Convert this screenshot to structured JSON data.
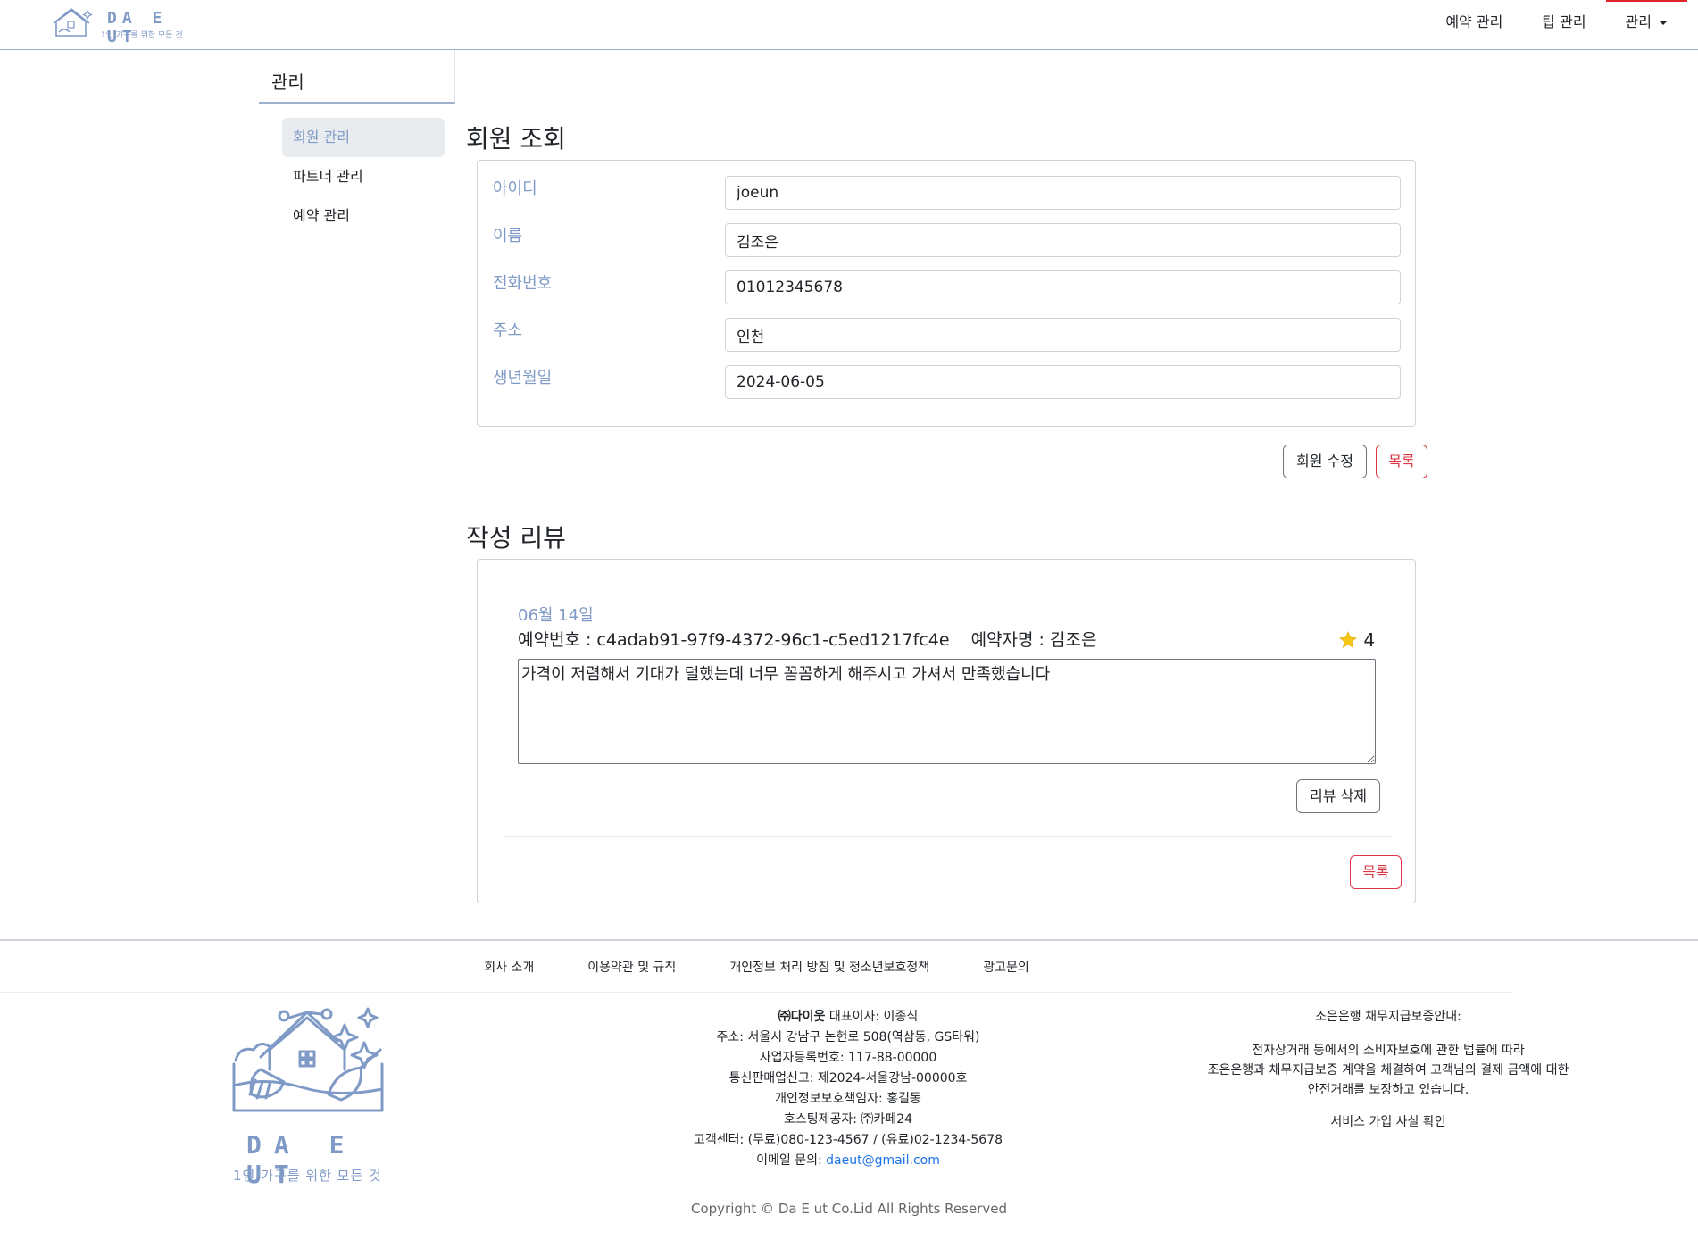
{
  "brand": {
    "name": "DA E UT",
    "tagline": "1인 가구를 위한 모든 것"
  },
  "nav": {
    "items": [
      "예약 관리",
      "팁 관리"
    ],
    "dropdown_label": "관리"
  },
  "sidebar": {
    "title": "관리",
    "items": [
      {
        "label": "회원 관리",
        "active": true
      },
      {
        "label": "파트너 관리",
        "active": false
      },
      {
        "label": "예약 관리",
        "active": false
      }
    ]
  },
  "member": {
    "title": "회원 조회",
    "fields": [
      {
        "label": "아이디",
        "value": "joeun"
      },
      {
        "label": "이름",
        "value": "김조은"
      },
      {
        "label": "전화번호",
        "value": "01012345678"
      },
      {
        "label": "주소",
        "value": "인천"
      },
      {
        "label": "생년월일",
        "value": "2024-06-05"
      }
    ],
    "edit_button": "회원 수정",
    "list_button": "목록"
  },
  "reviews": {
    "title": "작성 리뷰",
    "items": [
      {
        "date": "06월 14일",
        "reservation_label": "예약번호 : ",
        "reservation_no": "c4adab91-97f9-4372-96c1-c5ed1217fc4e",
        "booker_label": "예약자명 : ",
        "booker": "김조은",
        "rating": "4",
        "content": "가격이 저렴해서 기대가 덜했는데 너무 꼼꼼하게 해주시고 가셔서 만족했습니다",
        "delete_button": "리뷰 삭제"
      }
    ],
    "list_button": "목록"
  },
  "footer": {
    "links": [
      "회사 소개",
      "이용약관 및 규칙",
      "개인정보 처리 방침 및 청소년보호정책",
      "광고문의"
    ],
    "company": {
      "name": "㈜다이웃",
      "ceo": " 대표이사: 이종식",
      "address": "주소: 서울시 강남구 논현로 508(역삼동, GS타워)",
      "business_no": "사업자등록번호: 117-88-00000",
      "commerce_no": "통신판매업신고: 제2024-서울강남-00000호",
      "privacy_officer": "개인정보보호책임자: 홍길동",
      "hosting": "호스팅제공자: ㈜카페24",
      "customer_center": "고객센터: (무료)080-123-4567 / (유료)02-1234-5678",
      "email_label": "이메일 문의: ",
      "email": "daeut@gmail.com"
    },
    "guarantee": {
      "title": "조은은행 채무지급보증안내:",
      "line1": "전자상거래 등에서의 소비자보호에 관한 법률에 따라",
      "line2": "조은은행과 채무지급보증 계약을 체결하여 고객님의 결제 금액에 대한",
      "line3": "안전거래를 보장하고 있습니다.",
      "confirm": "서비스 가입 사실 확인"
    },
    "copyright": "Copyright © Da E ut Co.Lid All Rights Reserved"
  },
  "colors": {
    "accent": "#7f9ac6",
    "danger": "#dc3545",
    "star": "#f5c518"
  }
}
